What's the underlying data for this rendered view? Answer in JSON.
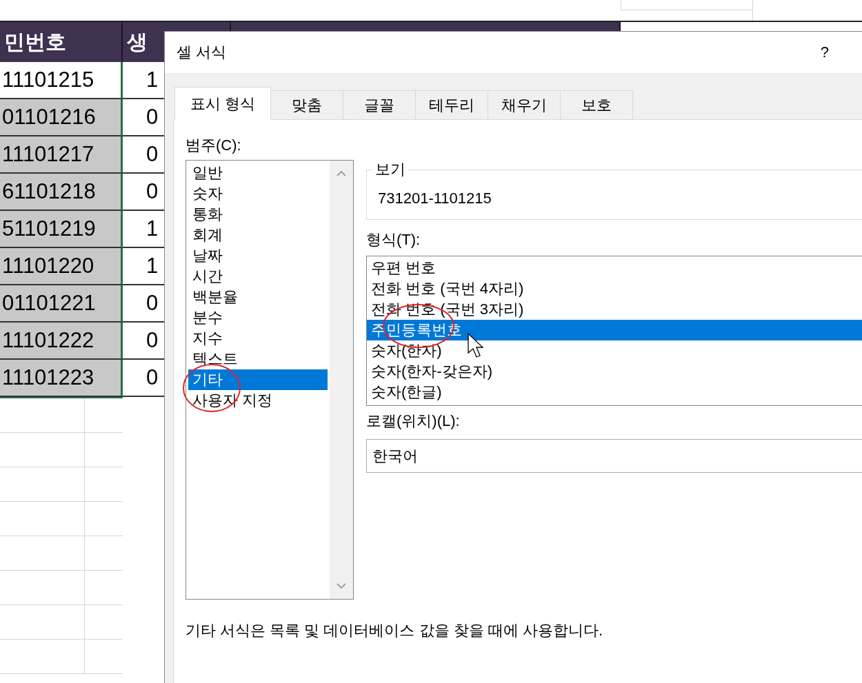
{
  "sheet": {
    "headers": [
      "민번호",
      "생"
    ],
    "rows": [
      {
        "cells": [
          "11101215",
          "1"
        ],
        "active": true
      },
      {
        "cells": [
          "01101216",
          "0"
        ],
        "active": false
      },
      {
        "cells": [
          "11101217",
          "0"
        ],
        "active": false
      },
      {
        "cells": [
          "61101218",
          "0"
        ],
        "active": false
      },
      {
        "cells": [
          "51101219",
          "1"
        ],
        "active": false
      },
      {
        "cells": [
          "11101220",
          "1"
        ],
        "active": false
      },
      {
        "cells": [
          "01101221",
          "0"
        ],
        "active": false
      },
      {
        "cells": [
          "11101222",
          "0"
        ],
        "active": false
      },
      {
        "cells": [
          "11101223",
          "0"
        ],
        "active": false
      }
    ]
  },
  "dialog": {
    "title": "셀 서식",
    "help": "?",
    "tabs": [
      {
        "label": "표시 형식",
        "selected": true
      },
      {
        "label": "맞춤",
        "selected": false
      },
      {
        "label": "글꼴",
        "selected": false
      },
      {
        "label": "테두리",
        "selected": false
      },
      {
        "label": "채우기",
        "selected": false
      },
      {
        "label": "보호",
        "selected": false
      }
    ],
    "category_label": "범주(C):",
    "categories": [
      {
        "label": "일반",
        "selected": false
      },
      {
        "label": "숫자",
        "selected": false
      },
      {
        "label": "통화",
        "selected": false
      },
      {
        "label": "회계",
        "selected": false
      },
      {
        "label": "날짜",
        "selected": false
      },
      {
        "label": "시간",
        "selected": false
      },
      {
        "label": "백분율",
        "selected": false
      },
      {
        "label": "분수",
        "selected": false
      },
      {
        "label": "지수",
        "selected": false
      },
      {
        "label": "텍스트",
        "selected": false
      },
      {
        "label": "기타",
        "selected": true
      },
      {
        "label": "사용자 지정",
        "selected": false
      }
    ],
    "sample_label": "보기",
    "sample_value": "731201-1101215",
    "type_label": "형식(T):",
    "types": [
      {
        "label": "우편 번호",
        "selected": false
      },
      {
        "label": "전화 번호 (국번 4자리)",
        "selected": false
      },
      {
        "label": "전화 번호 (국번 3자리)",
        "selected": false
      },
      {
        "label": "주민등록번호",
        "selected": true
      },
      {
        "label": "숫자(한자)",
        "selected": false
      },
      {
        "label": "숫자(한자-갖은자)",
        "selected": false
      },
      {
        "label": "숫자(한글)",
        "selected": false
      }
    ],
    "locale_label": "로캘(위치)(L):",
    "locale_value": "한국어",
    "description": "기타 서식은 목록 및 데이터베이스 값을 찾을 때에 사용합니다."
  }
}
